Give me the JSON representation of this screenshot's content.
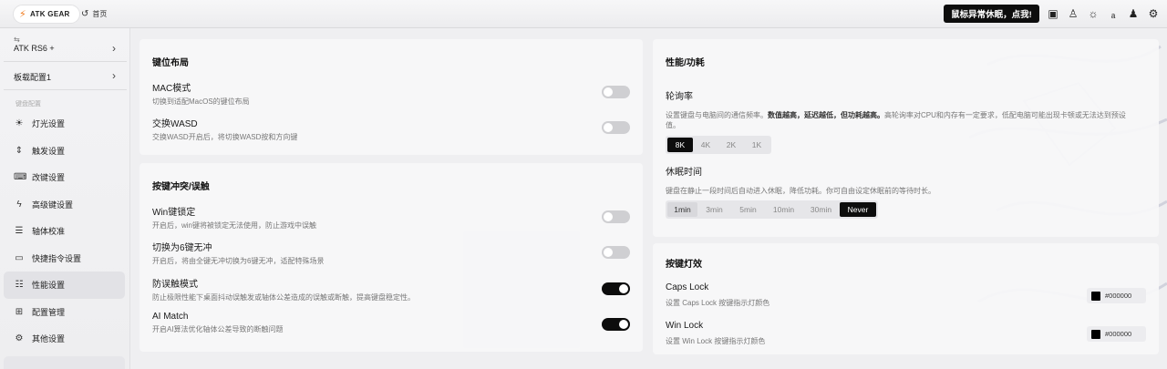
{
  "header": {
    "brand": "ATK GEAR",
    "home": "首页",
    "notice": "鼠标异常休眠，点我!",
    "icons": [
      "monitor-icon",
      "shirt-icon",
      "sun-icon",
      "translate-icon",
      "user-icon",
      "gear-icon"
    ]
  },
  "sidebar": {
    "device_name": "ATK RS6 +",
    "profile": "板载配置1",
    "group_label": "键盘配置",
    "items": [
      {
        "label": "灯光设置",
        "icon": "lightbulb-icon"
      },
      {
        "label": "触发设置",
        "icon": "trigger-icon"
      },
      {
        "label": "改键设置",
        "icon": "keyboard-icon"
      },
      {
        "label": "高级键设置",
        "icon": "lightning-icon"
      },
      {
        "label": "轴体校准",
        "icon": "calibrate-icon"
      },
      {
        "label": "快捷指令设置",
        "icon": "terminal-icon"
      },
      {
        "label": "性能设置",
        "icon": "sliders-icon",
        "active": true
      },
      {
        "label": "配置管理",
        "icon": "grid-icon"
      },
      {
        "label": "其他设置",
        "icon": "settings-icon"
      }
    ]
  },
  "layout_card": {
    "title": "键位布局",
    "rows": [
      {
        "label": "MAC模式",
        "desc": "切换到适配MacOS的键位布局",
        "on": false
      },
      {
        "label": "交换WASD",
        "desc": "交换WASD开启后，将切换WASD按和方向键",
        "on": false
      }
    ]
  },
  "conflict_card": {
    "title": "按键冲突/误触",
    "rows": [
      {
        "label": "Win键锁定",
        "desc": "开启后，win键将被锁定无法使用，防止游戏中误触",
        "on": false
      },
      {
        "label": "切换为6键无冲",
        "desc": "开启后，将由全键无冲切换为6键无冲，适配特殊场景",
        "on": false
      },
      {
        "label": "防误触模式",
        "desc": "防止极限性能下桌面抖动误触发或轴体公差造成的误触或断触，提高键盘稳定性。",
        "on": true
      },
      {
        "label": "AI Match",
        "desc": "开启AI算法优化轴体公差导致的断触问题",
        "on": true
      }
    ]
  },
  "perf_card": {
    "title": "性能/功耗",
    "polling": {
      "label": "轮询率",
      "desc_a": "设置键盘与电脑间的通信频率。",
      "desc_bold": "数值越高，延迟越低，但功耗越高。",
      "desc_b": "高轮询率对CPU和内存有一定要求，低配电脑可能出现卡顿或无法达到预设值。",
      "options": [
        "8K",
        "4K",
        "2K",
        "1K"
      ],
      "selected": "8K"
    },
    "sleep": {
      "label": "休眠时间",
      "desc": "键盘在静止一段时间后自动进入休眠，降低功耗。你可自由设定休眠前的等待时长。",
      "options": [
        "1min",
        "3min",
        "5min",
        "10min",
        "30min",
        "Never"
      ],
      "selected": "Never"
    }
  },
  "light_card": {
    "title": "按键灯效",
    "rows": [
      {
        "label": "Caps Lock",
        "desc": "设置 Caps Lock 按键指示灯颜色",
        "color": "#000000"
      },
      {
        "label": "Win Lock",
        "desc": "设置 Win Lock 按键指示灯颜色",
        "color": "#000000"
      }
    ]
  }
}
